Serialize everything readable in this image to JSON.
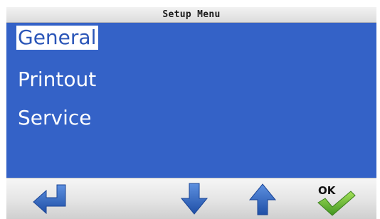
{
  "title": "Setup Menu",
  "menu": {
    "items": [
      {
        "label": "General",
        "selected": true
      },
      {
        "label": "Printout",
        "selected": false
      },
      {
        "label": "Service",
        "selected": false
      }
    ]
  },
  "toolbar": {
    "ok_label": "OK",
    "buttons": [
      {
        "icon": "enter-arrow-icon"
      },
      {
        "icon": "arrow-down-icon"
      },
      {
        "icon": "arrow-up-icon"
      },
      {
        "icon": "ok-check-icon"
      }
    ]
  },
  "colors": {
    "menu_background": "#3462c7",
    "icon_blue": "#2f67c4",
    "check_green": "#6bbf2a"
  }
}
